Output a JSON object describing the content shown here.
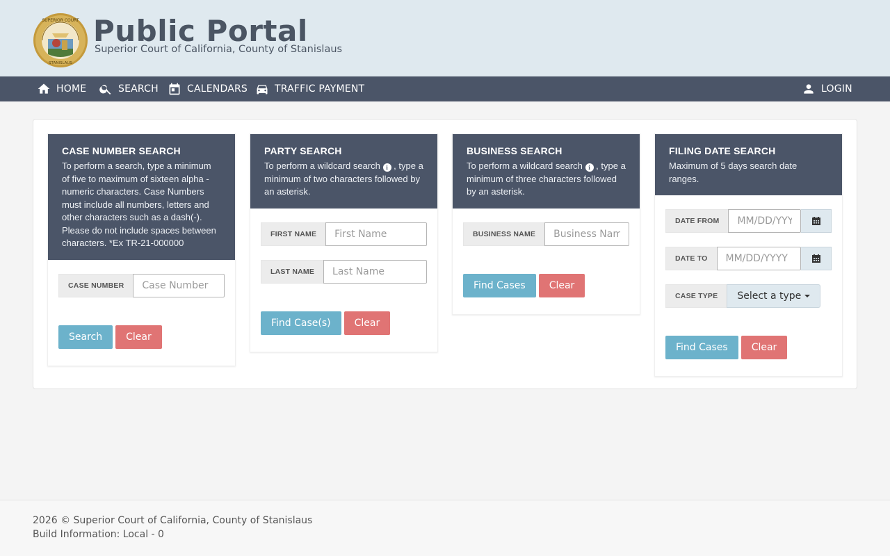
{
  "header": {
    "title": "Public Portal",
    "subtitle": "Superior Court of California, County of Stanislaus"
  },
  "nav": {
    "home": "HOME",
    "search": "SEARCH",
    "calendars": "CALENDARS",
    "traffic": "TRAFFIC PAYMENT",
    "login": "LOGIN"
  },
  "case_search": {
    "title": "CASE NUMBER SEARCH",
    "desc": "To perform a search, type a minimum of five to maximum of sixteen alpha - numeric characters. Case Numbers must include all numbers, letters and other characters such as a dash(-). Please do not include spaces between characters. *Ex TR-21-000000",
    "label": "CASE NUMBER",
    "placeholder": "Case Number",
    "value": "",
    "search_btn": "Search",
    "clear_btn": "Clear"
  },
  "party_search": {
    "title": "PARTY SEARCH",
    "desc_pre": "To perform a wildcard search",
    "desc_post": ", type a minimum of two characters followed by an asterisk.",
    "first_label": "FIRST NAME",
    "first_placeholder": "First Name",
    "last_label": "LAST NAME",
    "last_placeholder": "Last Name",
    "find_btn": "Find Case(s)",
    "clear_btn": "Clear"
  },
  "business_search": {
    "title": "BUSINESS SEARCH",
    "desc_pre": "To perform a wildcard search",
    "desc_post": ", type a minimum of three characters followed by an asterisk.",
    "label": "BUSINESS NAME",
    "placeholder": "Business Name",
    "find_btn": "Find Cases",
    "clear_btn": "Clear"
  },
  "filing_search": {
    "title": "FILING DATE SEARCH",
    "desc": "Maximum of 5 days search date ranges.",
    "from_label": "DATE FROM",
    "from_placeholder": "MM/DD/YYYY",
    "to_label": "DATE TO",
    "to_placeholder": "MM/DD/YYYY",
    "type_label": "CASE TYPE",
    "type_value": "Select a type",
    "find_btn": "Find Cases",
    "clear_btn": "Clear"
  },
  "footer": {
    "copyright": "2026 © Superior Court of California, County of Stanislaus",
    "build": "Build Information: Local - 0"
  },
  "icons": {
    "seal": "court-seal-icon",
    "home": "home-icon",
    "search": "search-icon",
    "calendars": "calendar-icon",
    "traffic": "car-icon",
    "login": "user-icon",
    "info": "info-icon"
  },
  "colors": {
    "header_bg": "#dfe9ef",
    "nav_bg": "#4b5568",
    "primary_btn": "#6cb2cb",
    "danger_btn": "#e07474"
  }
}
